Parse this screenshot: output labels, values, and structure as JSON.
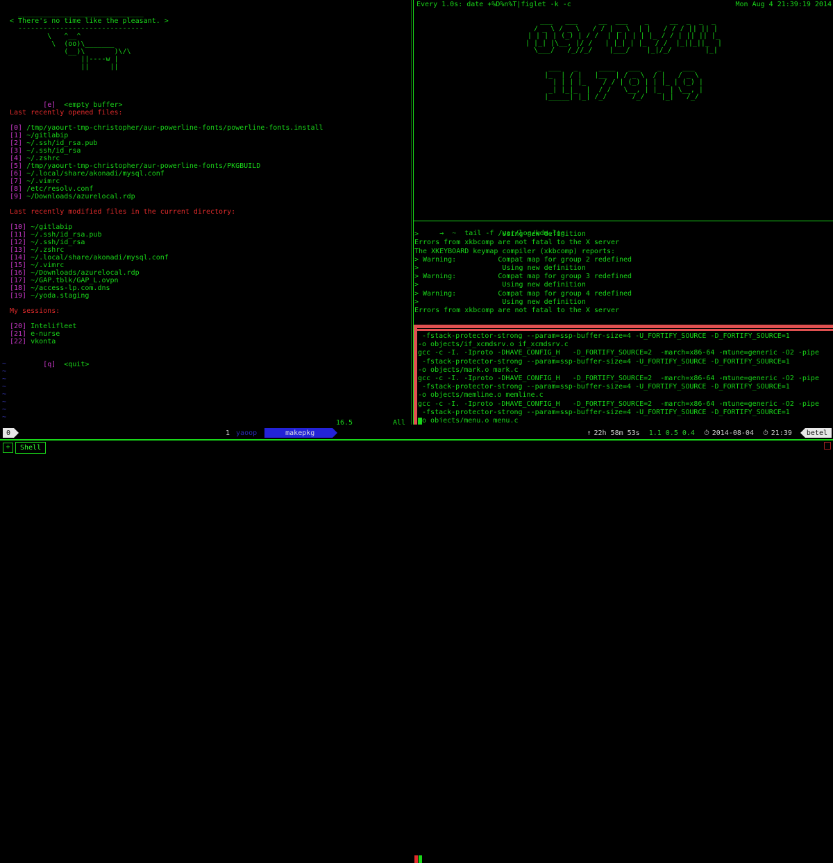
{
  "left_pane": {
    "cow_art": [
      "  ______________________________",
      "< There's no time like the pleasant. >",
      "  ------------------------------",
      "         \\   ^__^",
      "          \\  (oo)\\_______",
      "             (__)\\       )\\/\\",
      "                 ||----w |",
      "                 ||     ||"
    ],
    "empty_buffer": {
      "index": "[e]",
      "label": "<empty buffer>"
    },
    "recent_files_header": "Last recently opened files:",
    "recent_files": [
      {
        "index": "[0]",
        "path": "/tmp/yaourt-tmp-christopher/aur-powerline-fonts/powerline-fonts.install"
      },
      {
        "index": "[1]",
        "path": "~/gitlabip"
      },
      {
        "index": "[2]",
        "path": "~/.ssh/id_rsa.pub"
      },
      {
        "index": "[3]",
        "path": "~/.ssh/id_rsa"
      },
      {
        "index": "[4]",
        "path": "~/.zshrc"
      },
      {
        "index": "[5]",
        "path": "/tmp/yaourt-tmp-christopher/aur-powerline-fonts/PKGBUILD"
      },
      {
        "index": "[6]",
        "path": "~/.local/share/akonadi/mysql.conf"
      },
      {
        "index": "[7]",
        "path": "~/.vimrc"
      },
      {
        "index": "[8]",
        "path": "/etc/resolv.conf"
      },
      {
        "index": "[9]",
        "path": "~/Downloads/azurelocal.rdp"
      }
    ],
    "modified_files_header": "Last recently modified files in the current directory:",
    "modified_files": [
      {
        "index": "[10]",
        "path": "~/gitlabip"
      },
      {
        "index": "[11]",
        "path": "~/.ssh/id_rsa.pub"
      },
      {
        "index": "[12]",
        "path": "~/.ssh/id_rsa"
      },
      {
        "index": "[13]",
        "path": "~/.zshrc"
      },
      {
        "index": "[14]",
        "path": "~/.local/share/akonadi/mysql.conf"
      },
      {
        "index": "[15]",
        "path": "~/.vimrc"
      },
      {
        "index": "[16]",
        "path": "~/Downloads/azurelocal.rdp"
      },
      {
        "index": "[17]",
        "path": "~/GAP.tblk/GAP_L.ovpn"
      },
      {
        "index": "[18]",
        "path": "~/access-lp.com.dns"
      },
      {
        "index": "[19]",
        "path": "~/yoda.staging"
      }
    ],
    "sessions_header": "My sessions:",
    "sessions": [
      {
        "index": "[20]",
        "name": "Intelifleet"
      },
      {
        "index": "[21]",
        "name": "e-nurse"
      },
      {
        "index": "[22]",
        "name": "vkonta"
      }
    ],
    "quit": {
      "index": "[q]",
      "label": "<quit>"
    },
    "tilde_marker": "~",
    "tilde_count": 8,
    "ruler_position": "16,5",
    "ruler_percent": "All"
  },
  "watch_pane": {
    "command": "Every 1.0s: date +%D%n%T|figlet -k -c",
    "timestamp": "Mon Aug  4 21:39:19 2014",
    "date_value": "08/04/14",
    "time_value": "21:39:19",
    "date_figlet": [
      "  ___   ___     __  ___    _     __  _  _  _",
      " / _ \\ / _ \\   / / | _ \\  | |   / / / || || |",
      "| | | | (_) | / /  | | | | | |_ / / | || || |_",
      "| |_| |\\__, |/ /   | |_| | |_  / /  |_||_||_  |",
      " \\___/   /_//_/    |___/    |_|/_/        |_|"
    ],
    "time_figlet": [
      " ___   _     ____   ___    _     ___  ",
      "|_  | / |   |__  | / _ \\  / |   / _ \\ ",
      "  | | | |_    / / | (_) | | |_ | (_) |",
      " _| |_|_  |  / /   \\__, | |_  | \\__, |",
      "|_____| |_| /_/      /_/    |_|   /_/ "
    ]
  },
  "log_pane": {
    "prompt_arrow": "→",
    "prompt_path": "~",
    "command": "tail -f /var/log/kdm.log",
    "lines": [
      ">                    Using new definition",
      "Errors from xkbcomp are not fatal to the X server",
      "The XKEYBOARD keymap compiler (xkbcomp) reports:",
      "> Warning:          Compat map for group 2 redefined",
      ">                    Using new definition",
      "> Warning:          Compat map for group 3 redefined",
      ">                    Using new definition",
      "> Warning:          Compat map for group 4 redefined",
      ">                    Using new definition",
      "Errors from xkbcomp are not fatal to the X server"
    ]
  },
  "build_pane": {
    "border_color": "#e05050",
    "lines": [
      " -fstack-protector-strong --param=ssp-buffer-size=4 -U_FORTIFY_SOURCE -D_FORTIFY_SOURCE=1",
      "-o objects/if_xcmdsrv.o if_xcmdsrv.c",
      "gcc -c -I. -Iproto -DHAVE_CONFIG_H   -D_FORTIFY_SOURCE=2  -march=x86-64 -mtune=generic -O2 -pipe",
      " -fstack-protector-strong --param=ssp-buffer-size=4 -U_FORTIFY_SOURCE -D_FORTIFY_SOURCE=1",
      "-o objects/mark.o mark.c",
      "gcc -c -I. -Iproto -DHAVE_CONFIG_H   -D_FORTIFY_SOURCE=2  -march=x86-64 -mtune=generic -O2 -pipe",
      " -fstack-protector-strong --param=ssp-buffer-size=4 -U_FORTIFY_SOURCE -D_FORTIFY_SOURCE=1",
      "-o objects/memline.o memline.c",
      "gcc -c -I. -Iproto -DHAVE_CONFIG_H   -D_FORTIFY_SOURCE=2  -march=x86-64 -mtune=generic -O2 -pipe",
      " -fstack-protector-strong --param=ssp-buffer-size=4 -U_FORTIFY_SOURCE -D_FORTIFY_SOURCE=1",
      "-o objects/menu.o menu.c"
    ]
  },
  "status_bar": {
    "session_name": "0",
    "window_number": "1",
    "inactive_window": "yaoop",
    "active_window": "makepkg",
    "uptime_icon": "↑",
    "uptime": "22h 58m 53s",
    "load_avg": "1.1 0.5 0.4",
    "calendar_icon": "⏱",
    "date": "2014-08-04",
    "clock_icon": "⏱",
    "time": "21:39",
    "hostname": "betel"
  },
  "tab_bar": {
    "new_tab_label": "+",
    "tabs": [
      {
        "label": "Shell",
        "active": true
      }
    ]
  },
  "colors": {
    "green": "#19d719",
    "bright_green": "#33ff33",
    "red": "#e02b2b",
    "magenta": "#c838c8",
    "blue": "#2323d8",
    "white": "#e8e8e8",
    "background": "#000000"
  }
}
